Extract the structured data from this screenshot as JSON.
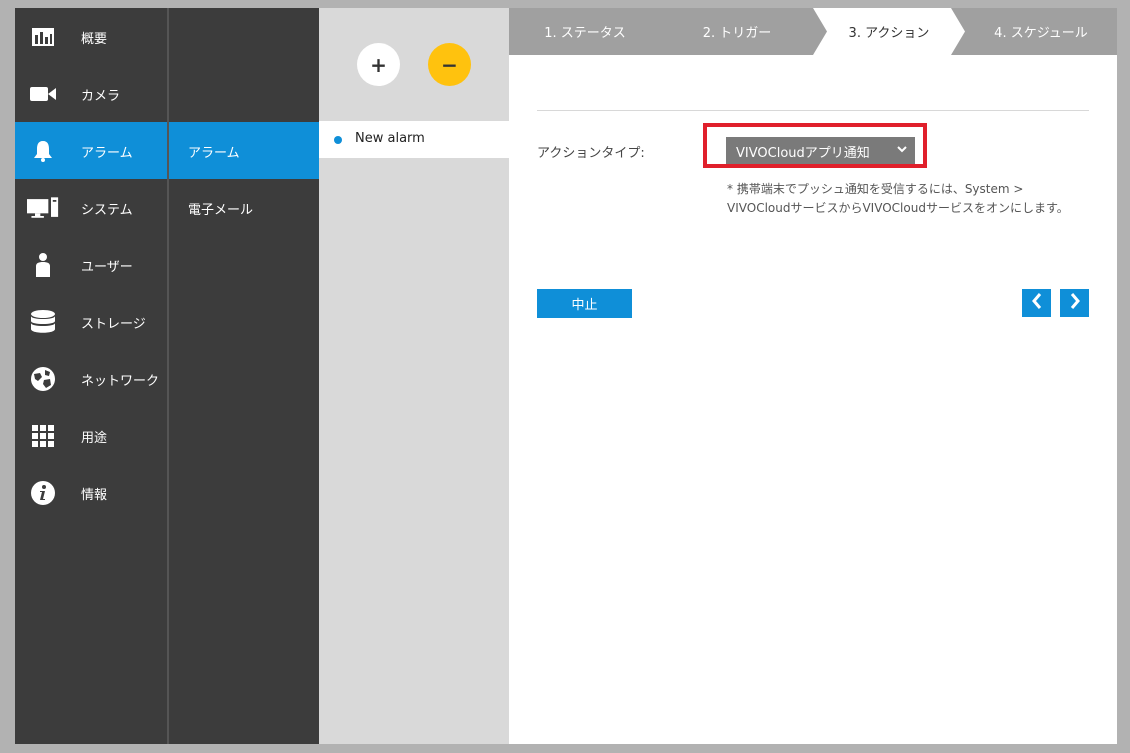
{
  "nav": {
    "items": [
      {
        "label": "概要",
        "icon": "bar-chart-icon"
      },
      {
        "label": "カメラ",
        "icon": "video-camera-icon"
      },
      {
        "label": "アラーム",
        "icon": "bell-icon",
        "active": true
      },
      {
        "label": "システム",
        "icon": "computer-icon"
      },
      {
        "label": "ユーザー",
        "icon": "user-icon"
      },
      {
        "label": "ストレージ",
        "icon": "database-icon"
      },
      {
        "label": "ネットワーク",
        "icon": "globe-icon"
      },
      {
        "label": "用途",
        "icon": "grid-icon"
      },
      {
        "label": "情報",
        "icon": "info-icon"
      }
    ]
  },
  "subnav": {
    "items": [
      {
        "label": "アラーム",
        "active": true
      },
      {
        "label": "電子メール"
      }
    ]
  },
  "alarm_list": {
    "add_label": "+",
    "remove_label": "−",
    "items": [
      {
        "label": "New alarm"
      }
    ]
  },
  "steps": [
    {
      "label": "1. ステータス"
    },
    {
      "label": "2. トリガー"
    },
    {
      "label": "3. アクション",
      "active": true
    },
    {
      "label": "4. スケジュール"
    }
  ],
  "form": {
    "action_type_label": "アクションタイプ:",
    "action_type_value": "VIVOCloudアプリ通知",
    "note": "* 携帯端末でプッシュ通知を受信するには、System > VIVOCloudサービスからVIVOCloudサービスをオンにします。"
  },
  "buttons": {
    "cancel": "中止",
    "prev": "‹",
    "next": "›"
  },
  "colors": {
    "accent": "#0f8fd8",
    "sidebar": "#3c3c3c",
    "warning": "#ffc20e",
    "highlight": "#e0202b"
  }
}
